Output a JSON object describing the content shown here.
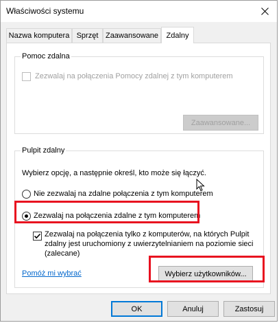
{
  "window": {
    "title": "Właściwości systemu"
  },
  "tabs": [
    {
      "label": "Nazwa komputera",
      "active": false
    },
    {
      "label": "Sprzęt",
      "active": false
    },
    {
      "label": "Zaawansowane",
      "active": false
    },
    {
      "label": "Zdalny",
      "active": true
    }
  ],
  "remote_assistance": {
    "legend": "Pomoc zdalna",
    "checkbox_label": "Zezwalaj na połączenia Pomocy zdalnej z tym komputerem",
    "checked": false,
    "enabled": false,
    "advanced_button": "Zaawansowane..."
  },
  "remote_desktop": {
    "legend": "Pulpit zdalny",
    "instruction": "Wybierz opcję, a następnie określ, kto może się łączyć.",
    "option_deny": "Nie zezwalaj na zdalne połączenia z tym komputerem",
    "option_allow": "Zezwalaj na połączenia zdalne z tym komputerem",
    "selected": "allow",
    "nla_line1": "Zezwalaj na połączenia tylko z komputerów, na których Pulpit",
    "nla_line2": "zdalny jest uruchomiony z uwierzytelnianiem na poziomie sieci",
    "nla_line3": "(zalecane)",
    "nla_checked": true,
    "help_link": "Pomóż mi wybrać",
    "select_users_button": "Wybierz użytkowników..."
  },
  "footer": {
    "ok": "OK",
    "cancel": "Anuluj",
    "apply": "Zastosuj"
  },
  "colors": {
    "highlight": "#e8101f",
    "link": "#0066cc",
    "default_button_border": "#0078d7"
  }
}
